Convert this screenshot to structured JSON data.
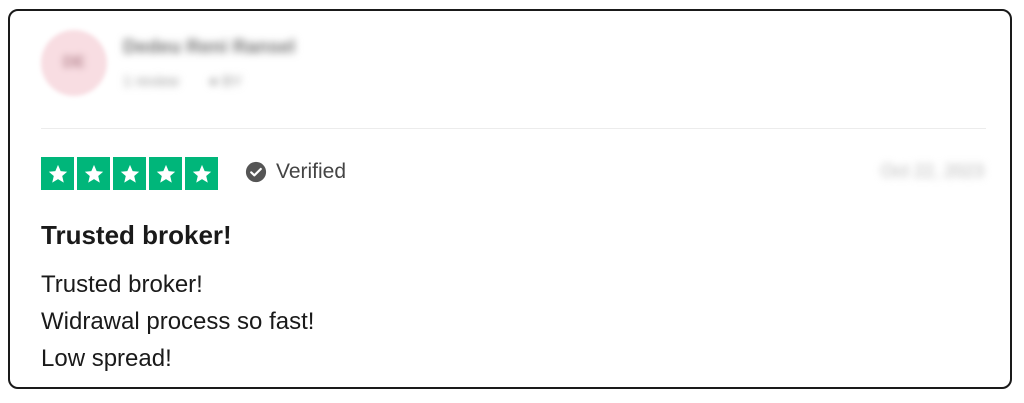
{
  "reviewer": {
    "initials": "DE",
    "name": "Dedeu Reni Ransel",
    "review_count": "1 review",
    "country": "BY"
  },
  "rating": {
    "stars": 5,
    "max_stars": 5,
    "color": "#00b67a"
  },
  "verified": {
    "label": "Verified",
    "icon": "check-circle-icon"
  },
  "review_date": "Oct 22, 2023",
  "review": {
    "title": "Trusted broker!",
    "lines": [
      "Trusted broker!",
      "Widrawal process so fast!",
      "Low spread!"
    ]
  }
}
